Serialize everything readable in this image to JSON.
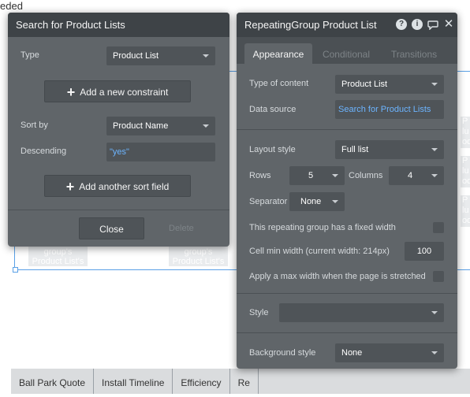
{
  "background": {
    "top_left_text": "eded",
    "cell_placeholder_text": "group's Product List's",
    "side_placeholder_text": "P lu od"
  },
  "footer_nav": {
    "items": [
      "Ball Park Quote",
      "Install Timeline",
      "Efficiency",
      "Re"
    ]
  },
  "search_panel": {
    "title": "Search for Product Lists",
    "type_label": "Type",
    "type_value": "Product List",
    "add_constraint_label": "Add a new constraint",
    "sort_by_label": "Sort by",
    "sort_by_value": "Product Name",
    "descending_label": "Descending",
    "descending_value": "\"yes\"",
    "add_sort_label": "Add another sort field",
    "close_label": "Close",
    "delete_label": "Delete"
  },
  "rg_panel": {
    "title": "RepeatingGroup Product List",
    "icons": [
      "help-icon",
      "info-icon",
      "comment-icon",
      "close-icon"
    ],
    "tabs": [
      "Appearance",
      "Conditional",
      "Transitions"
    ],
    "type_of_content_label": "Type of content",
    "type_of_content_value": "Product List",
    "data_source_label": "Data source",
    "data_source_value": "Search for Product Lists",
    "layout_style_label": "Layout style",
    "layout_style_value": "Full list",
    "rows_label": "Rows",
    "rows_value": "5",
    "columns_label": "Columns",
    "columns_value": "4",
    "separator_label": "Separator",
    "separator_value": "None",
    "fixed_width_label": "This repeating group has a fixed width",
    "cell_min_width_label": "Cell min width (current width: 214px)",
    "cell_min_width_value": "100",
    "max_width_label": "Apply a max width when the page is stretched",
    "style_label": "Style",
    "style_value": "",
    "background_style_label": "Background style",
    "background_style_value": "None"
  },
  "colors": {
    "panel_bg": "#606569",
    "header_bg": "#3e4347",
    "link_blue": "#6cb4ff",
    "selection_blue": "#5aa0e6"
  }
}
